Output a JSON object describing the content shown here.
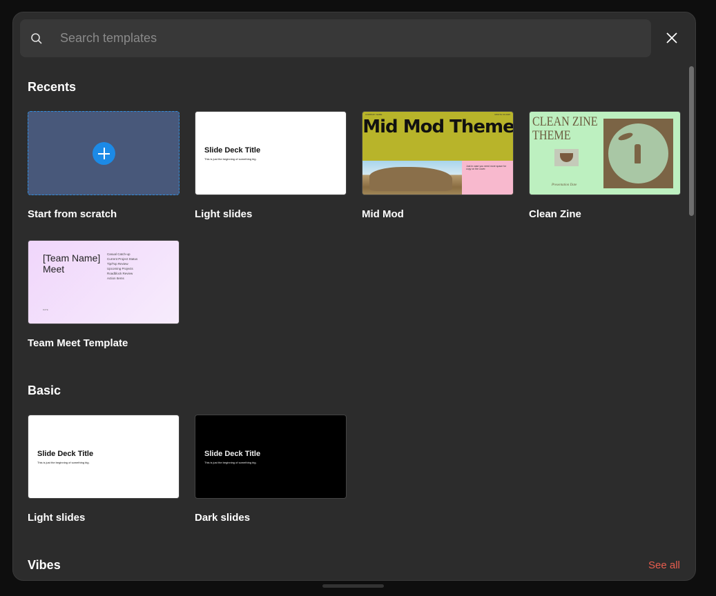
{
  "search": {
    "placeholder": "Search templates",
    "value": ""
  },
  "icons": {
    "search": "search-icon",
    "close": "close-icon",
    "plus": "plus-icon"
  },
  "sections": {
    "recents": {
      "title": "Recents",
      "items": [
        {
          "label": "Start from scratch"
        },
        {
          "label": "Light slides",
          "thumb_title": "Slide Deck Title",
          "thumb_sub": "This is just the beginning of something big."
        },
        {
          "label": "Mid Mod",
          "thumb_title": "Mid Mod Theme",
          "thumb_top_left": "COMPANY NAME",
          "thumb_top_right": "MONTH 00 2025",
          "thumb_text": "Just in case you need more space for copy on the cover."
        },
        {
          "label": "Clean Zine",
          "thumb_title": "CLEAN ZINE THEME",
          "thumb_sub": "Presentation Date"
        },
        {
          "label": "Team Meet Template",
          "thumb_title": "[Team Name] Meet",
          "thumb_agenda": [
            "Casual Catch-up",
            "Current Project Status",
            "Tip/Top Review",
            "Upcoming Projects",
            "Roadblock Review",
            "Action Items"
          ],
          "thumb_date": "DATE"
        }
      ]
    },
    "basic": {
      "title": "Basic",
      "items": [
        {
          "label": "Light slides",
          "thumb_title": "Slide Deck Title",
          "thumb_sub": "This is just the beginning of something big."
        },
        {
          "label": "Dark slides",
          "thumb_title": "Slide Deck Title",
          "thumb_sub": "This is just the beginning of something big."
        }
      ]
    },
    "vibes": {
      "title": "Vibes",
      "see_all": "See all"
    }
  },
  "colors": {
    "accent": "#1c8ae6",
    "see_all": "#e85d4e",
    "modal_bg": "#2c2c2c",
    "backdrop": "#0e0e0e"
  }
}
